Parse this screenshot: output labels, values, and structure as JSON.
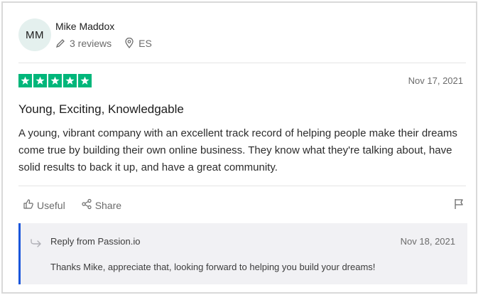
{
  "reviewer": {
    "initials": "MM",
    "name": "Mike Maddox",
    "reviews_count": "3 reviews",
    "country": "ES"
  },
  "review": {
    "rating": 5,
    "rating_max": 5,
    "star_color": "#00b67a",
    "date": "Nov 17, 2021",
    "title": "Young, Exciting, Knowledgable",
    "body": "A young, vibrant company with an excellent track record of helping people make their dreams come true by building their own online business. They know what they're talking about, have solid results to back it up, and have a great community."
  },
  "actions": {
    "useful_label": "Useful",
    "share_label": "Share"
  },
  "reply": {
    "from": "Reply from Passion.io",
    "date": "Nov 18, 2021",
    "text": "Thanks Mike, appreciate that, looking forward to helping you build your dreams!",
    "accent_color": "#1a56db"
  },
  "icons": [
    "pencil-icon",
    "location-pin-icon",
    "star-icon",
    "thumbs-up-icon",
    "share-icon",
    "flag-icon",
    "reply-arrow-icon"
  ]
}
